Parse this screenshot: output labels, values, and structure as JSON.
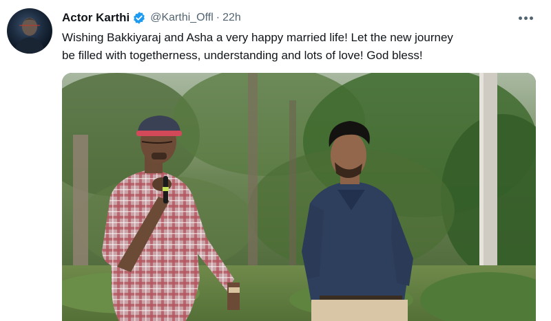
{
  "tweet": {
    "author": {
      "display_name": "Actor Karthi",
      "handle": "@Karthi_Offl",
      "verified": true,
      "avatar_icon": "profile-avatar"
    },
    "separator": "·",
    "timestamp": "22h",
    "text_lines": [
      "Wishing Bakkiyaraj and Asha a very happy married life! Let the new journey",
      "be filled with togetherness, understanding and lots of love! God bless!"
    ],
    "more_icon": "more-options-icon",
    "media": {
      "type": "photo"
    }
  },
  "colors": {
    "text_primary": "#0f1419",
    "text_secondary": "#536471",
    "verified_blue": "#1d9bf0"
  }
}
